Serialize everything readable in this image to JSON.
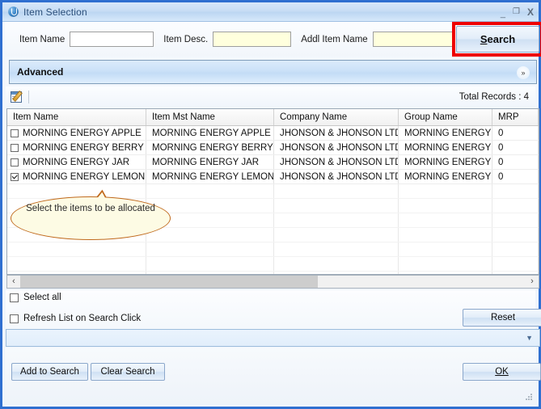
{
  "window": {
    "title": "Item Selection",
    "icon": "app-circle-icon",
    "controls": {
      "minimize": "_",
      "maximize": "❐",
      "close": "X"
    }
  },
  "search_bar": {
    "item_name": {
      "label": "Item Name",
      "value": "",
      "placeholder": ""
    },
    "item_desc": {
      "label": "Item Desc.",
      "value": "",
      "placeholder": ""
    },
    "addl_item_name": {
      "label": "Addl Item Name",
      "value": "",
      "placeholder": ""
    },
    "search_button": {
      "label": "Search",
      "accel": "S",
      "highlight_color": "#ee0000"
    }
  },
  "advanced": {
    "label": "Advanced",
    "expander": "»"
  },
  "toolbar": {
    "edit_icon": "edit-document-icon",
    "total_records_label": "Total Records : 4"
  },
  "grid": {
    "columns": [
      "Item Name",
      "Item Mst Name",
      "Company Name",
      "Group Name",
      "MRP"
    ],
    "rows": [
      {
        "checked": false,
        "item_name": "MORNING ENERGY APPLE",
        "item_mst_name": "MORNING ENERGY APPLE",
        "company_name": "JHONSON & JHONSON LTD",
        "group_name": "MORNING ENERGY",
        "mrp": "0"
      },
      {
        "checked": false,
        "item_name": "MORNING ENERGY BERRY",
        "item_mst_name": "MORNING ENERGY BERRY",
        "company_name": "JHONSON & JHONSON LTD",
        "group_name": "MORNING ENERGY",
        "mrp": "0"
      },
      {
        "checked": false,
        "item_name": "MORNING ENERGY JAR",
        "item_mst_name": "MORNING ENERGY JAR",
        "company_name": "JHONSON & JHONSON LTD",
        "group_name": "MORNING ENERGY",
        "mrp": "0"
      },
      {
        "checked": true,
        "item_name": "MORNING ENERGY LEMON",
        "item_mst_name": "MORNING ENERGY LEMON",
        "company_name": "JHONSON & JHONSON LTD",
        "group_name": "MORNING ENERGY",
        "mrp": "0"
      }
    ]
  },
  "callout": {
    "text": "Select the items to be allocated",
    "border_color": "#c0691c",
    "fill_color": "#fdfbe4"
  },
  "scrollbar": {
    "left_arrow": "‹",
    "right_arrow": "›"
  },
  "options": {
    "select_all": {
      "label": "Select all",
      "checked": false
    },
    "refresh_list": {
      "label": "Refresh List on Search Click",
      "checked": false
    },
    "reset_button": {
      "label": "Reset",
      "accel": "t"
    }
  },
  "collapsed_panel": {
    "expander": "▼"
  },
  "footer": {
    "add_to_search": {
      "label": "Add to Search",
      "accel": "dd"
    },
    "clear_search": {
      "label": "Clear Search",
      "accel": "r"
    },
    "ok": {
      "label": "OK",
      "accel": "O"
    }
  }
}
